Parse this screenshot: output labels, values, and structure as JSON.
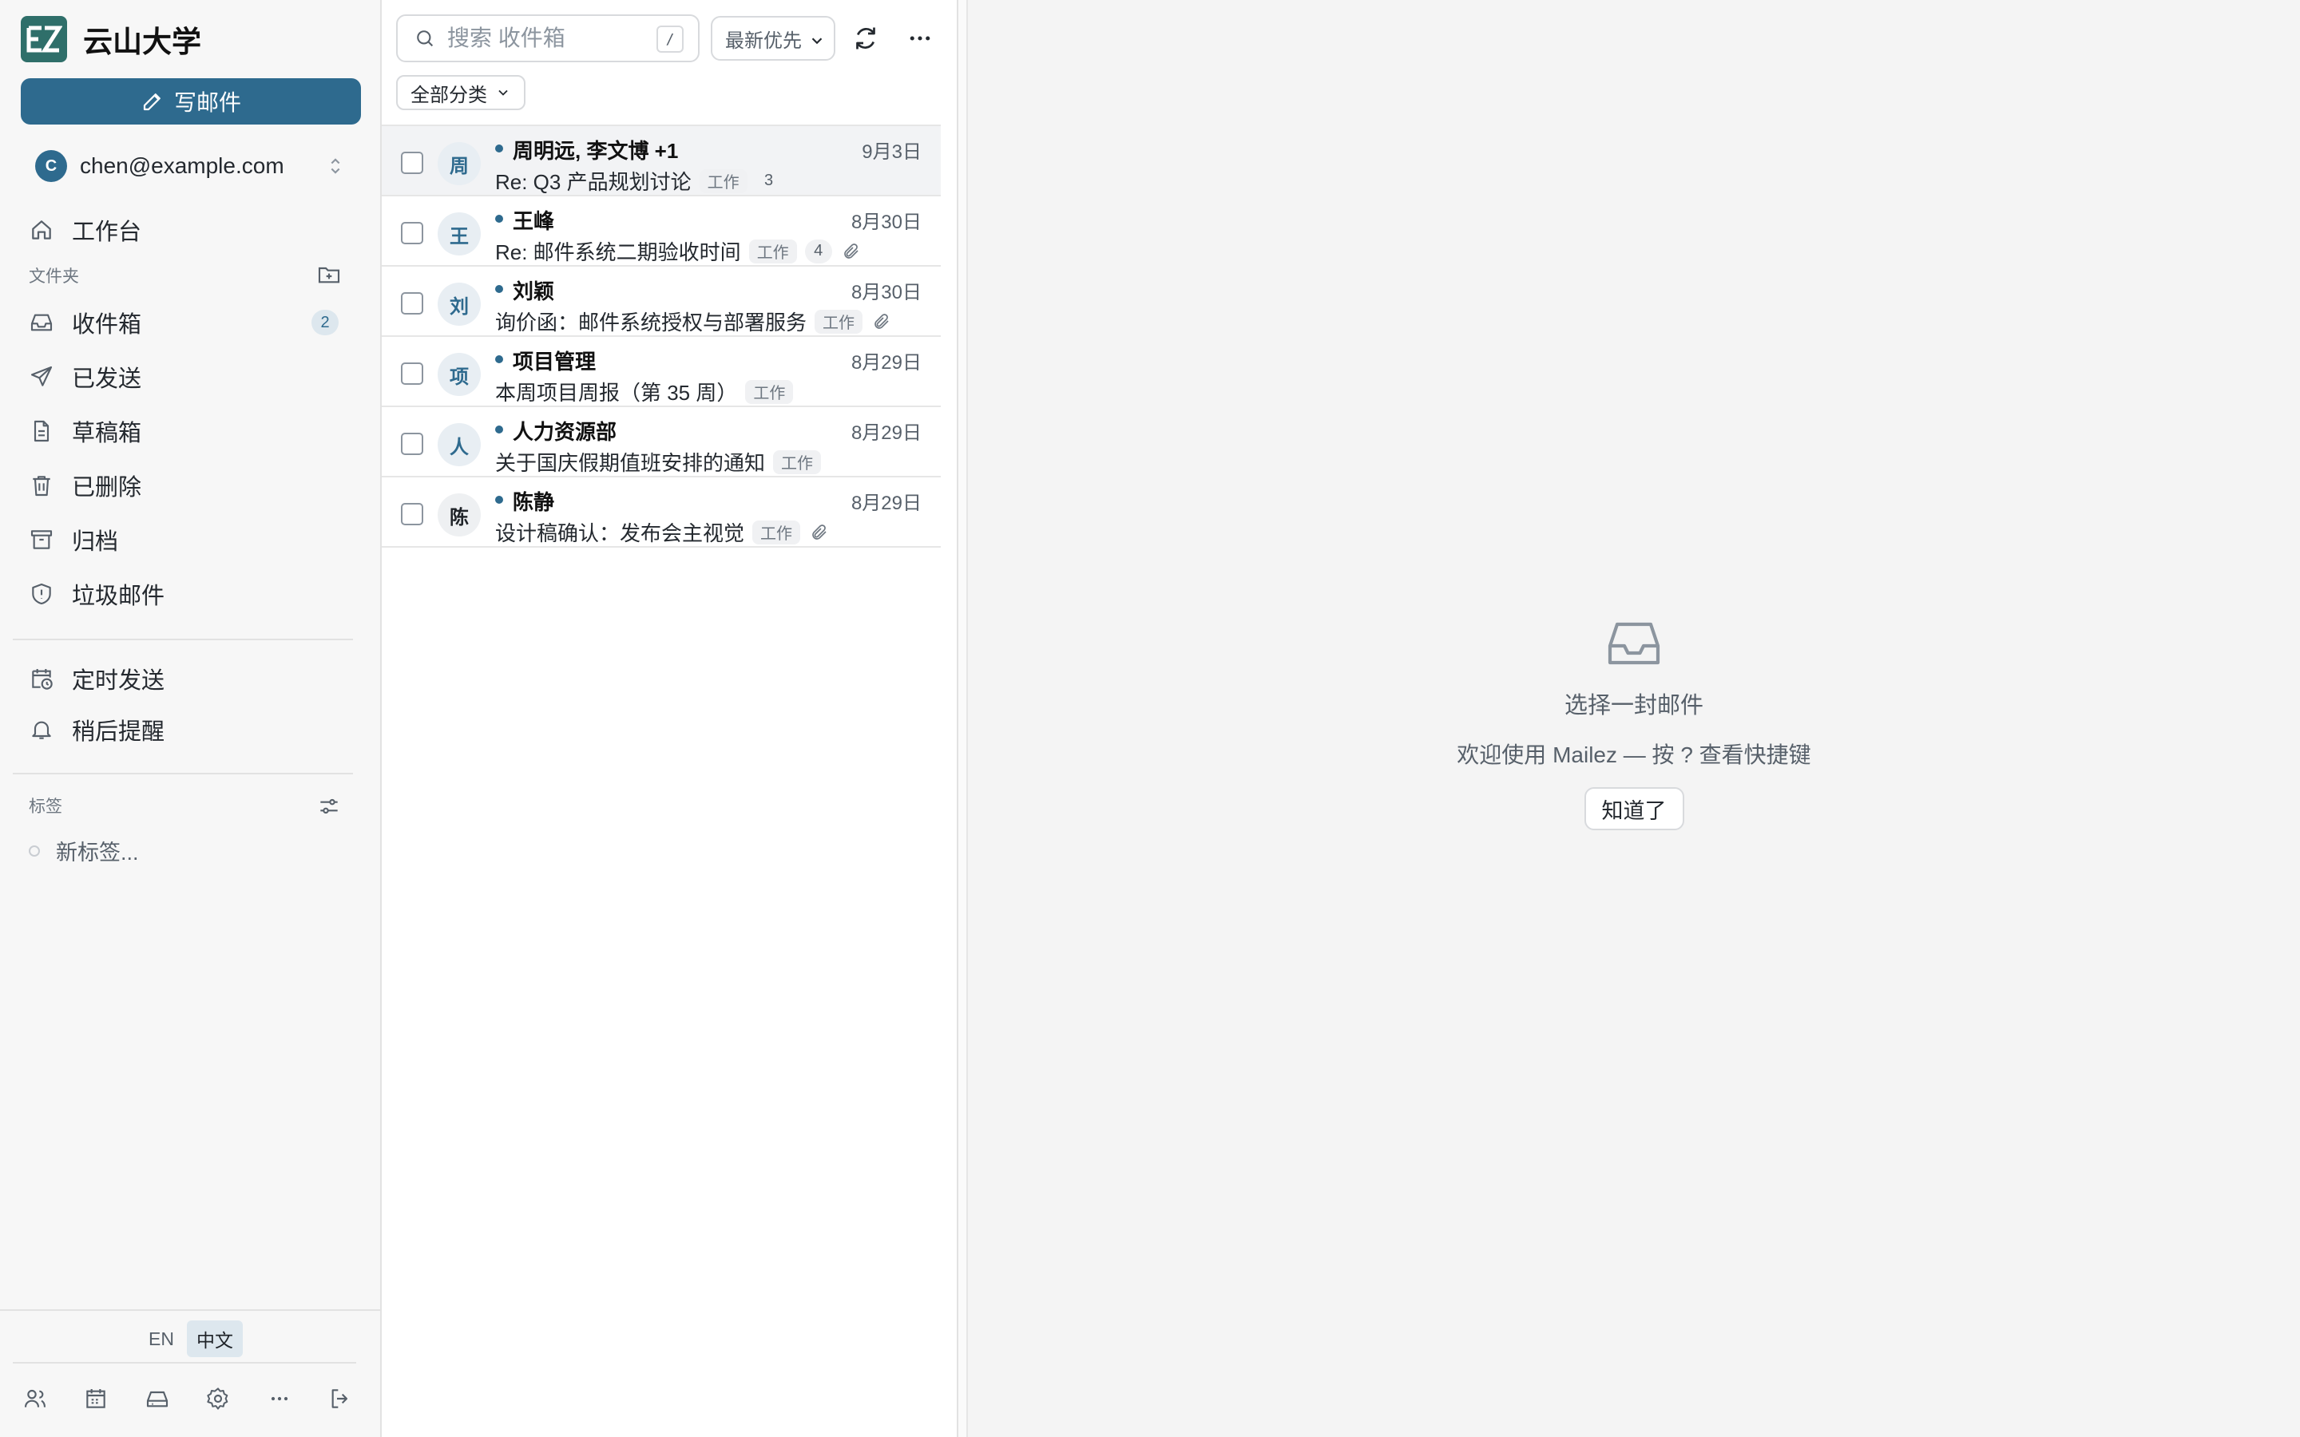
{
  "app": {
    "org_name": "云山大学",
    "logo_text": "EZ",
    "accent": "#2e6a8e"
  },
  "sidebar": {
    "compose_label": "写邮件",
    "account": {
      "initial": "C",
      "email": "chen@example.com"
    },
    "workbench_label": "工作台",
    "folders_label": "文件夹",
    "folders": [
      {
        "label": "收件箱",
        "icon": "inbox-icon",
        "badge": "2"
      },
      {
        "label": "已发送",
        "icon": "send-icon"
      },
      {
        "label": "草稿箱",
        "icon": "draft-icon"
      },
      {
        "label": "已删除",
        "icon": "trash-icon"
      },
      {
        "label": "归档",
        "icon": "archive-icon"
      },
      {
        "label": "垃圾邮件",
        "icon": "shield-icon"
      }
    ],
    "extras": [
      {
        "label": "定时发送",
        "icon": "calendar-clock-icon"
      },
      {
        "label": "稍后提醒",
        "icon": "bell-icon"
      }
    ],
    "tags_label": "标签",
    "new_tag_label": "新标签...",
    "languages": [
      "EN",
      "中文"
    ],
    "active_language": "中文"
  },
  "toolbar": {
    "search_placeholder": "搜索 收件箱",
    "search_shortcut": "/",
    "sort_label": "最新优先",
    "category_label": "全部分类"
  },
  "emails": [
    {
      "initial": "周",
      "sender": "周明远, 李文博 +1",
      "date": "9月3日",
      "subject": "Re: Q3 产品规划讨论",
      "tag": "工作",
      "count": "3",
      "attachment": false,
      "unread": true
    },
    {
      "initial": "王",
      "sender": "王峰",
      "date": "8月30日",
      "subject": "Re: 邮件系统二期验收时间",
      "tag": "工作",
      "count": "4",
      "attachment": true,
      "unread": true
    },
    {
      "initial": "刘",
      "sender": "刘颖",
      "date": "8月30日",
      "subject": "询价函：邮件系统授权与部署服务",
      "tag": "工作",
      "count": "",
      "attachment": true,
      "unread": true
    },
    {
      "initial": "项",
      "sender": "项目管理",
      "date": "8月29日",
      "subject": "本周项目周报（第 35 周）",
      "tag": "工作",
      "count": "",
      "attachment": false,
      "unread": true
    },
    {
      "initial": "人",
      "sender": "人力资源部",
      "date": "8月29日",
      "subject": "关于国庆假期值班安排的通知",
      "tag": "工作",
      "count": "",
      "attachment": false,
      "unread": true
    },
    {
      "initial": "陈",
      "sender": "陈静",
      "date": "8月29日",
      "subject": "设计稿确认：发布会主视觉",
      "tag": "工作",
      "count": "",
      "attachment": true,
      "unread": true
    }
  ],
  "reading": {
    "empty_title": "选择一封邮件",
    "empty_hint": "欢迎使用 Mailez — 按 ? 查看快捷键",
    "got_it_label": "知道了"
  }
}
